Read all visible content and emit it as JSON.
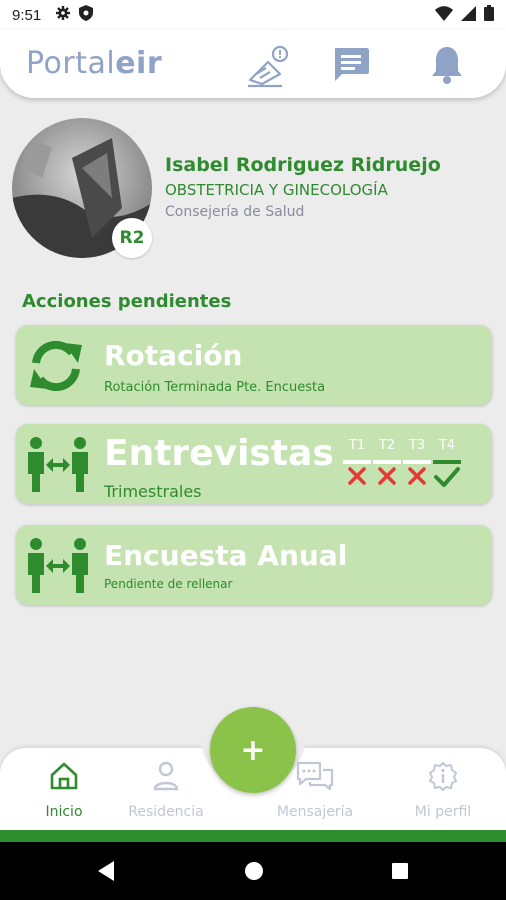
{
  "status_bar": {
    "time": "9:51"
  },
  "header": {
    "logo_regular": "Portal",
    "logo_bold": "eir"
  },
  "profile": {
    "name": "Isabel Rodriguez Ridruejo",
    "specialty": "OBSTETRICIA Y GINECOLOGÍA",
    "organization": "Consejería de Salud",
    "level": "R2"
  },
  "section_title": "Acciones pendientes",
  "cards": [
    {
      "title": "Rotación",
      "subtitle": "Rotación Terminada Pte. Encuesta",
      "icon": "sync-icon"
    },
    {
      "title": "Entrevistas",
      "subtitle": "Trimestrales",
      "icon": "people-exchange-icon",
      "quarters": [
        {
          "label": "T1",
          "status": "pending"
        },
        {
          "label": "T2",
          "status": "pending"
        },
        {
          "label": "T3",
          "status": "pending"
        },
        {
          "label": "T4",
          "status": "done"
        }
      ]
    },
    {
      "title": "Encuesta Anual",
      "subtitle": "Pendiente de rellenar",
      "icon": "people-exchange-icon"
    }
  ],
  "fab": {
    "label": "+"
  },
  "nav": [
    {
      "label": "Inicio",
      "icon": "home-icon",
      "active": true
    },
    {
      "label": "Residencia",
      "icon": "person-icon",
      "active": false
    },
    {
      "label": "Mensajería",
      "icon": "chat-icon",
      "active": false
    },
    {
      "label": "Mi perfil",
      "icon": "info-gear-icon",
      "active": false
    }
  ],
  "colors": {
    "primary_green": "#2e8b2e",
    "card_bg": "#c5e3b0",
    "fab": "#8bc34a",
    "logo": "#8fa3c6",
    "error_red": "#e53935"
  }
}
